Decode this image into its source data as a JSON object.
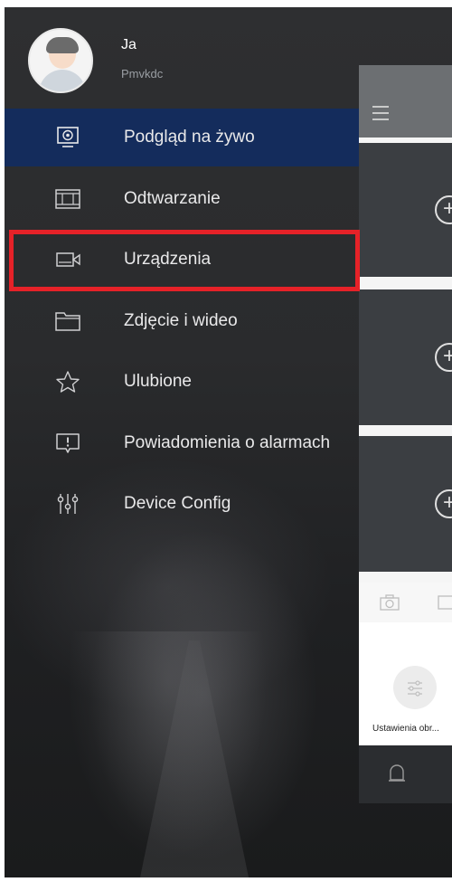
{
  "user": {
    "name": "Ja",
    "subtitle": "Pmvkdc"
  },
  "menu": {
    "items": [
      {
        "label": "Podgląd na żywo",
        "icon": "monitor-icon",
        "active": true
      },
      {
        "label": "Odtwarzanie",
        "icon": "film-icon",
        "active": false
      },
      {
        "label": "Urządzenia",
        "icon": "camera-device-icon",
        "active": false,
        "highlighted": true
      },
      {
        "label": "Zdjęcie i wideo",
        "icon": "folder-icon",
        "active": false
      },
      {
        "label": "Ulubione",
        "icon": "star-icon",
        "active": false
      },
      {
        "label": "Powiadomienia o alarmach",
        "icon": "alarm-message-icon",
        "active": false
      },
      {
        "label": "Device Config",
        "icon": "sliders-icon",
        "active": false
      }
    ]
  },
  "main_panel": {
    "settings_button_label": "Ustawienia obr..."
  },
  "colors": {
    "active_item": "#142c5c",
    "highlight_box": "#e62228"
  }
}
